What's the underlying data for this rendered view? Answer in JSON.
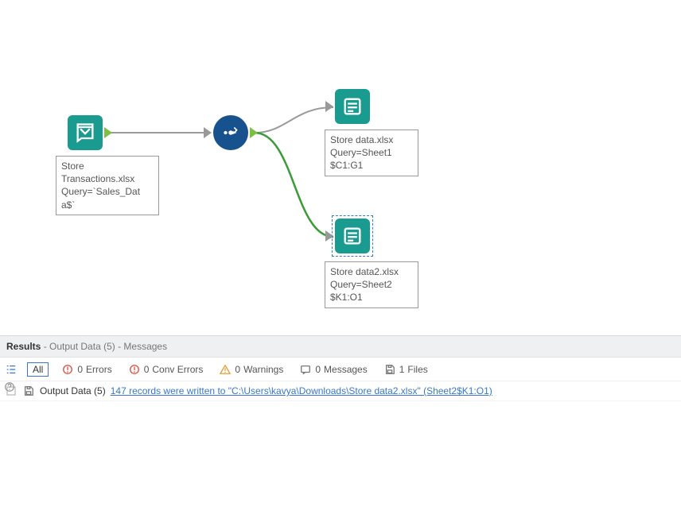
{
  "canvas": {
    "nodes": {
      "input": {
        "label_lines": "Store\nTransactions.xlsx\nQuery=`Sales_Dat\na$`"
      },
      "select": {},
      "output1": {
        "label_lines": "Store data.xlsx\nQuery=Sheet1\n$C1:G1"
      },
      "output2": {
        "label_lines": "Store data2.xlsx\nQuery=Sheet2\n$K1:O1"
      }
    }
  },
  "results": {
    "header": {
      "title": "Results",
      "subtitle": "- Output Data (5) - Messages"
    },
    "filters": {
      "all": "All",
      "errors_count": "0",
      "errors_label": "Errors",
      "conv_errors_count": "0",
      "conv_errors_label": "Conv Errors",
      "warnings_count": "0",
      "warnings_label": "Warnings",
      "messages_count": "0",
      "messages_label": "Messages",
      "files_count": "1",
      "files_label": "Files"
    },
    "log": {
      "source": "Output Data (5)",
      "message": "147 records were written to \"C:\\Users\\kavya\\Downloads\\Store data2.xlsx\" (Sheet2$K1:O1)"
    }
  }
}
